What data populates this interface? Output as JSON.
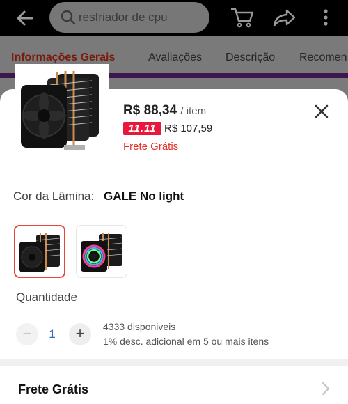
{
  "search": {
    "placeholder": "resfriador de cpu"
  },
  "tabs": [
    {
      "label": "Informações Gerais"
    },
    {
      "label": "Avaliações"
    },
    {
      "label": "Descrição"
    },
    {
      "label": "Recomen"
    }
  ],
  "product": {
    "price": "R$ 88,34",
    "price_unit": "/ item",
    "promo_badge": "11.11",
    "old_price": "R$ 107,59",
    "shipping": "Frete Grátis"
  },
  "color": {
    "label": "Cor da Lâmina:",
    "value": "GALE No light"
  },
  "quantity": {
    "label": "Quantidade",
    "minus": "−",
    "plus": "+",
    "value": "1",
    "stock": "4333 disponiveis",
    "discount": "1% desc. adicional em 5 ou mais itens"
  },
  "shipping_row": {
    "title": "Frete Grátis"
  },
  "colors": {
    "accent": "#e8183d",
    "link": "#2a6fbf",
    "active_tab": "#7a1a0d"
  }
}
